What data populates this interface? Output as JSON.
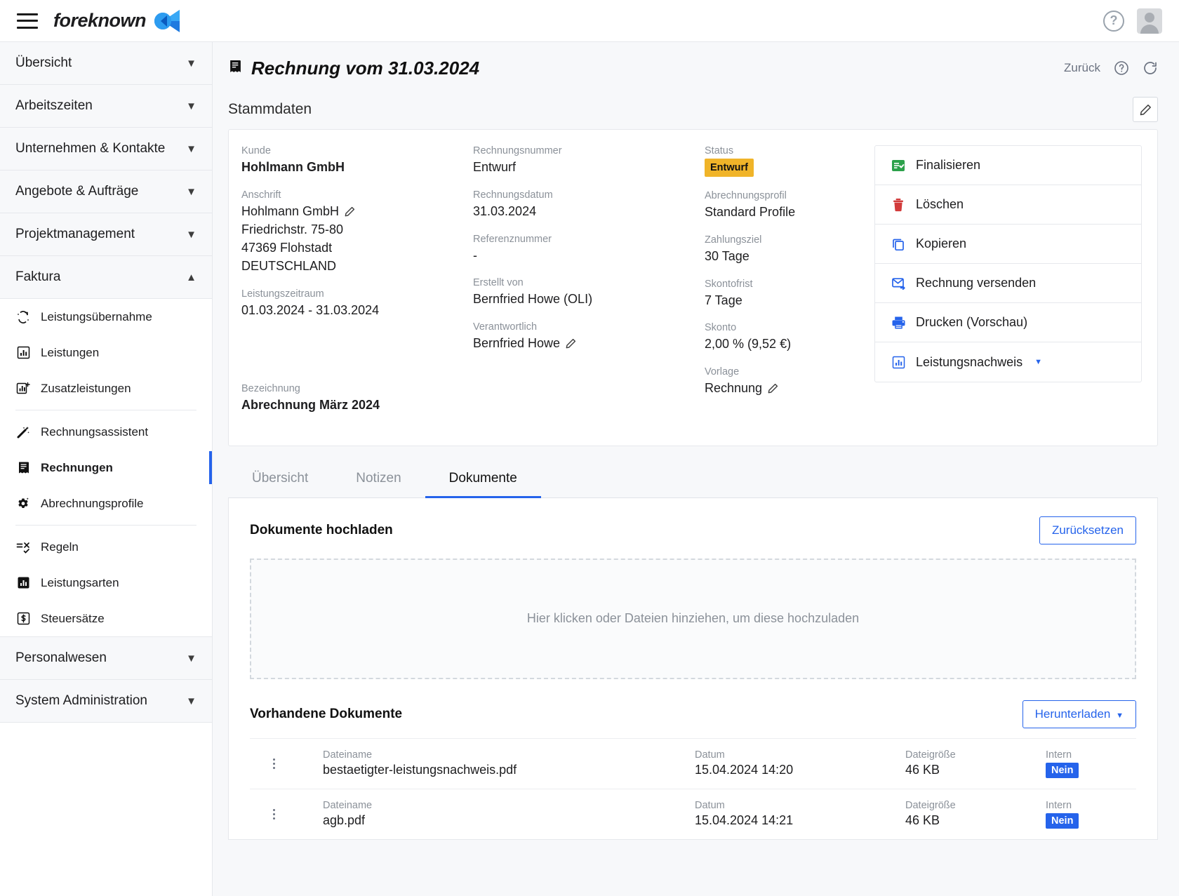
{
  "topbar": {
    "brand": "foreknown",
    "menu_icon": "hamburger-icon",
    "help_icon": "help-circle-icon",
    "avatar": "user-avatar"
  },
  "sidebar": {
    "groups": [
      {
        "label": "Übersicht",
        "expanded": false
      },
      {
        "label": "Arbeitszeiten",
        "expanded": false
      },
      {
        "label": "Unternehmen & Kontakte",
        "expanded": false
      },
      {
        "label": "Angebote & Aufträge",
        "expanded": false
      },
      {
        "label": "Projektmanagement",
        "expanded": false
      },
      {
        "label": "Faktura",
        "expanded": true
      }
    ],
    "faktura_items": [
      {
        "label": "Leistungsübernahme",
        "icon": "transfer-icon",
        "active": false
      },
      {
        "label": "Leistungen",
        "icon": "chart-bar-icon",
        "active": false
      },
      {
        "label": "Zusatzleistungen",
        "icon": "chart-bar-plus-icon",
        "active": false
      },
      {
        "label": "Rechnungsassistent",
        "icon": "magic-wand-icon",
        "active": false
      },
      {
        "label": "Rechnungen",
        "icon": "invoice-icon",
        "active": true
      },
      {
        "label": "Abrechnungsprofile",
        "icon": "gear-plus-icon",
        "active": false
      },
      {
        "label": "Regeln",
        "icon": "rules-icon",
        "active": false
      },
      {
        "label": "Leistungsarten",
        "icon": "chart-bar-filled-icon",
        "active": false
      },
      {
        "label": "Steuersätze",
        "icon": "currency-icon",
        "active": false
      }
    ],
    "bottom_groups": [
      {
        "label": "Personalwesen",
        "expanded": false
      },
      {
        "label": "System Administration",
        "expanded": false
      }
    ]
  },
  "page": {
    "title": "Rechnung vom 31.03.2024",
    "title_icon": "invoice-icon",
    "back_label": "Zurück",
    "help_icon": "help-circle-icon",
    "refresh_icon": "refresh-icon",
    "section_title": "Stammdaten",
    "edit_icon": "pencil-icon"
  },
  "stammdaten": {
    "kunde_label": "Kunde",
    "kunde_value": "Hohlmann GmbH",
    "anschrift_label": "Anschrift",
    "anschrift_lines": [
      "Hohlmann GmbH",
      "Friedrichstr. 75-80",
      "47369 Flohstadt",
      "DEUTSCHLAND"
    ],
    "leistungszeitraum_label": "Leistungszeitraum",
    "leistungszeitraum_value": "01.03.2024 - 31.03.2024",
    "bezeichnung_label": "Bezeichnung",
    "bezeichnung_value": "Abrechnung März 2024",
    "rechnungsnummer_label": "Rechnungsnummer",
    "rechnungsnummer_value": "Entwurf",
    "rechnungsdatum_label": "Rechnungsdatum",
    "rechnungsdatum_value": "31.03.2024",
    "referenznummer_label": "Referenznummer",
    "referenznummer_value": "-",
    "erstellt_von_label": "Erstellt von",
    "erstellt_von_value": "Bernfried Howe (OLI)",
    "verantwortlich_label": "Verantwortlich",
    "verantwortlich_value": "Bernfried Howe",
    "status_label": "Status",
    "status_value": "Entwurf",
    "status_color": "#f0b429",
    "abrechnungsprofil_label": "Abrechnungsprofil",
    "abrechnungsprofil_value": "Standard Profile",
    "zahlungsziel_label": "Zahlungsziel",
    "zahlungsziel_value": "30  Tage",
    "skontofrist_label": "Skontofrist",
    "skontofrist_value": "7  Tage",
    "skonto_label": "Skonto",
    "skonto_value": "2,00 %  (9,52 €)",
    "vorlage_label": "Vorlage",
    "vorlage_value": "Rechnung"
  },
  "actions": [
    {
      "label": "Finalisieren",
      "icon": "finalize-icon",
      "color": "#2ca14b",
      "caret": false
    },
    {
      "label": "Löschen",
      "icon": "trash-icon",
      "color": "#d23b3b",
      "caret": false
    },
    {
      "label": "Kopieren",
      "icon": "copy-icon",
      "color": "#2563eb",
      "caret": false
    },
    {
      "label": "Rechnung versenden",
      "icon": "mail-send-icon",
      "color": "#2563eb",
      "caret": false
    },
    {
      "label": "Drucken (Vorschau)",
      "icon": "printer-icon",
      "color": "#2563eb",
      "caret": false
    },
    {
      "label": "Leistungsnachweis",
      "icon": "chart-bar-icon",
      "color": "#2563eb",
      "caret": true
    }
  ],
  "tabs": [
    {
      "label": "Übersicht",
      "active": false
    },
    {
      "label": "Notizen",
      "active": false
    },
    {
      "label": "Dokumente",
      "active": true
    }
  ],
  "documents": {
    "upload_title": "Dokumente hochladen",
    "reset_label": "Zurücksetzen",
    "dropzone_text": "Hier klicken oder Dateien hinziehen, um diese hochzuladen",
    "existing_title": "Vorhandene Dokumente",
    "download_label": "Herunterladen",
    "columns": {
      "name": "Dateiname",
      "date": "Datum",
      "size": "Dateigröße",
      "intern": "Intern"
    },
    "rows": [
      {
        "name": "bestaetigter-leistungsnachweis.pdf",
        "date": "15.04.2024 14:20",
        "size": "46 KB",
        "intern": "Nein"
      },
      {
        "name": "agb.pdf",
        "date": "15.04.2024 14:21",
        "size": "46 KB",
        "intern": "Nein"
      }
    ]
  },
  "colors": {
    "accent": "#2563eb",
    "warning": "#f0b429",
    "danger": "#d23b3b",
    "success": "#2ca14b"
  }
}
